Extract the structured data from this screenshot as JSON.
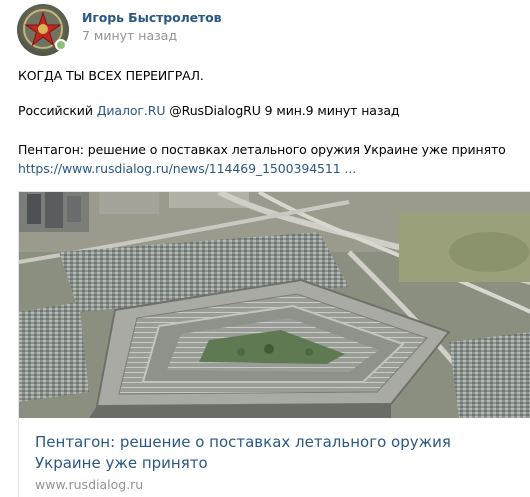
{
  "post": {
    "author": "Игорь Быстролетов",
    "time": "7 минут назад",
    "text_line1": "КОГДА ТЫ ВСЕХ ПЕРЕИГРАЛ.",
    "source_prefix": "Российский ",
    "source_link": "Диалог.RU",
    "source_suffix": " @RusDialogRU 9 мин.9 минут назад",
    "headline": "Пентагон: решение о поставках летального оружия Украине уже принято",
    "url": "https://www.rusdialog.ru/news/114469_1500394511 ..."
  },
  "card": {
    "title": "Пентагон: решение о поставках летального оружия Украине уже принято",
    "domain": "www.rusdialog.ru"
  },
  "colors": {
    "link": "#2a5885",
    "muted": "#939393",
    "online": "#8ac176"
  },
  "icons": {
    "avatar": "red-star-emblem"
  }
}
